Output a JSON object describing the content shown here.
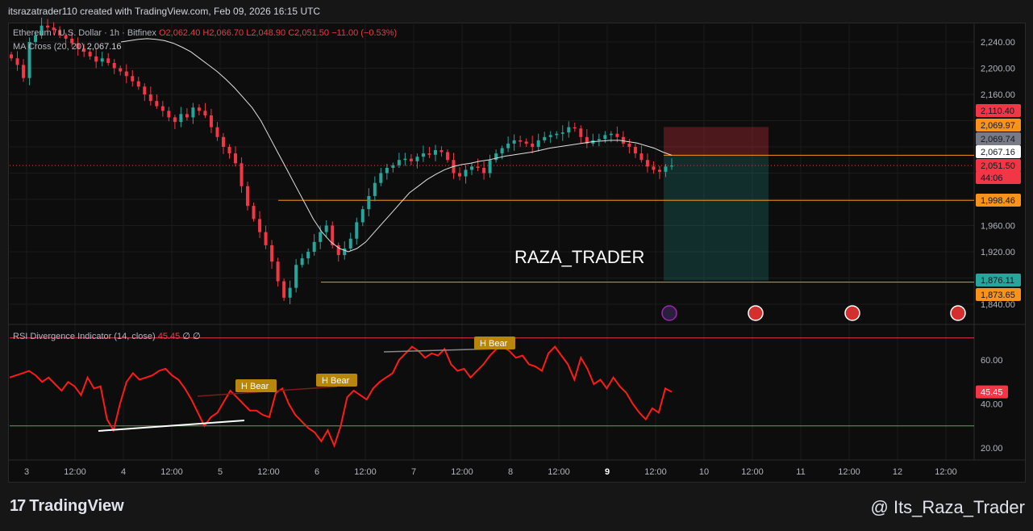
{
  "header": {
    "text": "itsrazatrader110 created with TradingView.com, Feb 09, 2026 16:15 UTC"
  },
  "legend": {
    "symbol": "Ethereum / U.S. Dollar · 1h · Bitfinex",
    "o": "O2,062.40",
    "h": "H2,066.70",
    "l": "L2,048.90",
    "c": "C2,051.50",
    "chg": "−11.00 (−0.53%)",
    "ma_label": "MA Cross (20, 20)",
    "ma_value": "2,067.16",
    "rsi_label": "RSI Divergence Indicator (14, close)",
    "rsi_value": "45.45",
    "rsi_extra": "∅ ∅"
  },
  "watermark": "RAZA_TRADER",
  "footer": {
    "logo": "TradingView",
    "logo_mark": "17",
    "handle": "@ Its_Raza_Trader"
  },
  "colors": {
    "up": "#26a69a",
    "down": "#f23645",
    "ma": "#e0e0e0",
    "level": "#f7931a",
    "rsi": "#ff1a1a"
  },
  "price_labels": [
    {
      "text": "2,110.40",
      "bg": "#f23645"
    },
    {
      "text": "2,069.97",
      "bg": "#f7931a"
    },
    {
      "text": "2,069.74",
      "bg": "#787b86"
    },
    {
      "text": "2,067.16",
      "bg": "#ffffff"
    },
    {
      "text": "2,051.50",
      "bg": "#f23645"
    },
    {
      "text": "44:06",
      "bg": "#f23645"
    },
    {
      "text": "1,998.46",
      "bg": "#f7931a"
    },
    {
      "text": "1,876.11",
      "bg": "#26a69a"
    },
    {
      "text": "1,873.65",
      "bg": "#f7931a"
    }
  ],
  "rsi_labels": [
    {
      "text": "H Bear"
    },
    {
      "text": "H Bear"
    },
    {
      "text": "H Bear"
    }
  ],
  "rsi_current": "45.45",
  "chart_data": [
    {
      "type": "candlestick",
      "title": "Ethereum / U.S. Dollar · 1h · Bitfinex",
      "ylim": [
        1820,
        2270
      ],
      "y_ticks": [
        "2,240.00",
        "2,200.00",
        "2,160.00",
        "1,960.00",
        "1,920.00",
        "1,840.00"
      ],
      "x_ticks": [
        "3",
        "12:00",
        "4",
        "12:00",
        "5",
        "12:00",
        "6",
        "12:00",
        "7",
        "12:00",
        "8",
        "12:00",
        "9",
        "12:00",
        "10",
        "12:00",
        "11",
        "12:00",
        "12",
        "12:00"
      ],
      "close_path": [
        2215,
        2205,
        2185,
        2240,
        2250,
        2265,
        2262,
        2258,
        2250,
        2245,
        2238,
        2230,
        2225,
        2218,
        2210,
        2215,
        2208,
        2200,
        2195,
        2188,
        2180,
        2172,
        2160,
        2150,
        2142,
        2135,
        2125,
        2118,
        2130,
        2125,
        2140,
        2135,
        2128,
        2110,
        2095,
        2080,
        2070,
        2055,
        2020,
        1990,
        1970,
        1950,
        1930,
        1905,
        1875,
        1850,
        1865,
        1900,
        1910,
        1920,
        1935,
        1950,
        1960,
        1930,
        1915,
        1925,
        1940,
        1965,
        1985,
        2005,
        2025,
        2040,
        2048,
        2052,
        2060,
        2062,
        2058,
        2065,
        2070,
        2068,
        2075,
        2072,
        2060,
        2040,
        2035,
        2045,
        2050,
        2048,
        2040,
        2060,
        2070,
        2078,
        2085,
        2090,
        2088,
        2085,
        2080,
        2090,
        2095,
        2098,
        2100,
        2102,
        2110,
        2108,
        2095,
        2085,
        2090,
        2092,
        2098,
        2100,
        2095,
        2085,
        2080,
        2070,
        2060,
        2050,
        2045,
        2042,
        2050,
        2051.5
      ],
      "ma_path": [
        2240,
        2242,
        2244,
        2245,
        2244,
        2242,
        2238,
        2232,
        2225,
        2215,
        2205,
        2195,
        2183,
        2170,
        2155,
        2140,
        2120,
        2095,
        2070,
        2045,
        2020,
        1995,
        1970,
        1950,
        1935,
        1925,
        1920,
        1925,
        1935,
        1950,
        1965,
        1980,
        1995,
        2010,
        2020,
        2030,
        2038,
        2045,
        2050,
        2053,
        2055,
        2058,
        2060,
        2063,
        2066,
        2068,
        2070,
        2072,
        2075,
        2078,
        2080,
        2082,
        2084,
        2086,
        2088,
        2089,
        2090,
        2090,
        2088,
        2086,
        2082,
        2078,
        2072,
        2067.16
      ],
      "levels": [
        2067.16,
        1998.46,
        1873.65
      ],
      "position": {
        "stop": 2110.4,
        "entry": 2067.16,
        "target": 1876.11
      },
      "current": 2051.5
    },
    {
      "type": "line",
      "title": "RSI Divergence Indicator (14, close)",
      "ylim": [
        15,
        75
      ],
      "y_ticks": [
        "60.00",
        "40.00",
        "20.00"
      ],
      "levels": [
        70,
        30
      ],
      "values": [
        52,
        53,
        54,
        55,
        53,
        50,
        52,
        49,
        46,
        50,
        48,
        44,
        52,
        47,
        48,
        33,
        28,
        40,
        50,
        54,
        51,
        52,
        53,
        55,
        56,
        53,
        51,
        47,
        42,
        36,
        30,
        34,
        36,
        41,
        46,
        43,
        40,
        37,
        37,
        35,
        34,
        45,
        47,
        40,
        35,
        32,
        29,
        27,
        23,
        28,
        21,
        30,
        43,
        46,
        44,
        42,
        47,
        50,
        52,
        54,
        60,
        63,
        66,
        64,
        61,
        63,
        62,
        65,
        58,
        55,
        56,
        52,
        55,
        58,
        62,
        65,
        66,
        64,
        61,
        62,
        58,
        57,
        55,
        63,
        66,
        62,
        58,
        51,
        61,
        56,
        49,
        51,
        47,
        52,
        48,
        45,
        40,
        36,
        33,
        38,
        36,
        47,
        45.45
      ],
      "annotations": [
        "H Bear",
        "H Bear",
        "H Bear"
      ]
    }
  ]
}
